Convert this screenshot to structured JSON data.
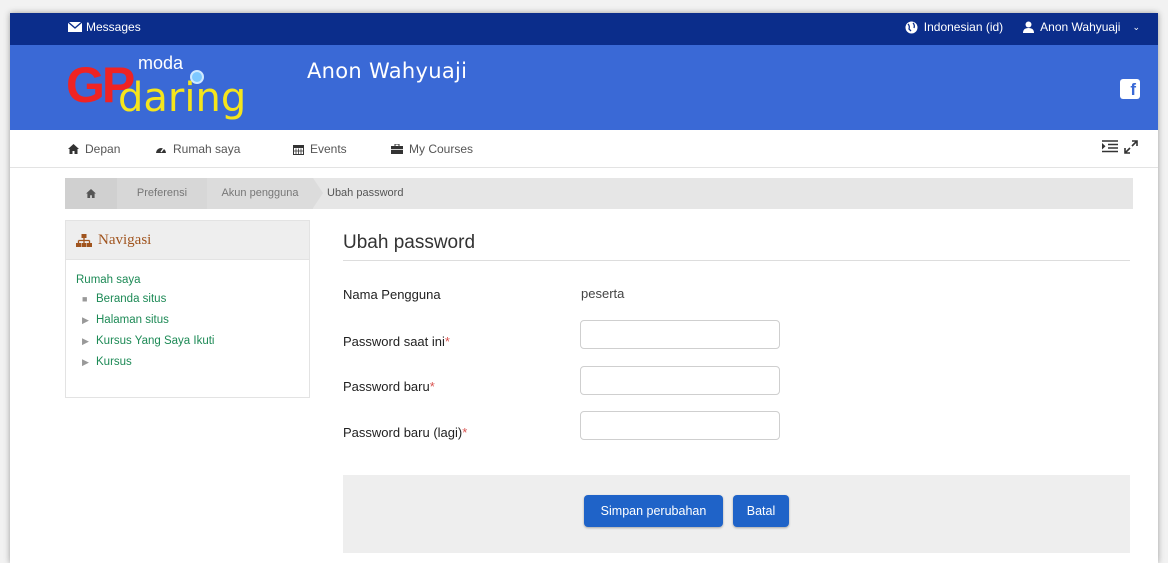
{
  "topbar": {
    "messages_label": "Messages",
    "language_label": "Indonesian (id)",
    "user_name": "Anon Wahyuaji"
  },
  "header": {
    "logo": {
      "gp": "GP",
      "moda": "moda",
      "daring": "daring"
    },
    "site_name": "Anon Wahyuaji",
    "facebook_glyph": "f"
  },
  "navbar": {
    "items": [
      {
        "label": "Depan",
        "icon": "home-icon"
      },
      {
        "label": "Rumah saya",
        "icon": "dashboard-icon"
      },
      {
        "label": "Events",
        "icon": "calendar-icon"
      },
      {
        "label": "My Courses",
        "icon": "briefcase-icon"
      }
    ]
  },
  "breadcrumb": {
    "items": [
      "Preferensi",
      "Akun pengguna",
      "Ubah password"
    ]
  },
  "navigation_block": {
    "title": "Navigasi",
    "root": "Rumah saya",
    "items": [
      "Beranda situs",
      "Halaman situs",
      "Kursus Yang Saya Ikuti",
      "Kursus"
    ]
  },
  "form": {
    "title": "Ubah password",
    "username_label": "Nama Pengguna",
    "username_value": "peserta",
    "current_password_label": "Password saat ini",
    "new_password_label": "Password baru",
    "new_password_again_label": "Password baru (lagi)",
    "required_mark": "*",
    "save_label": "Simpan perubahan",
    "cancel_label": "Batal"
  },
  "colors": {
    "topbar": "#0b2d8b",
    "header": "#3a69d6",
    "button": "#1f63c8",
    "link": "#1d8a56",
    "required": "#d9534f"
  }
}
